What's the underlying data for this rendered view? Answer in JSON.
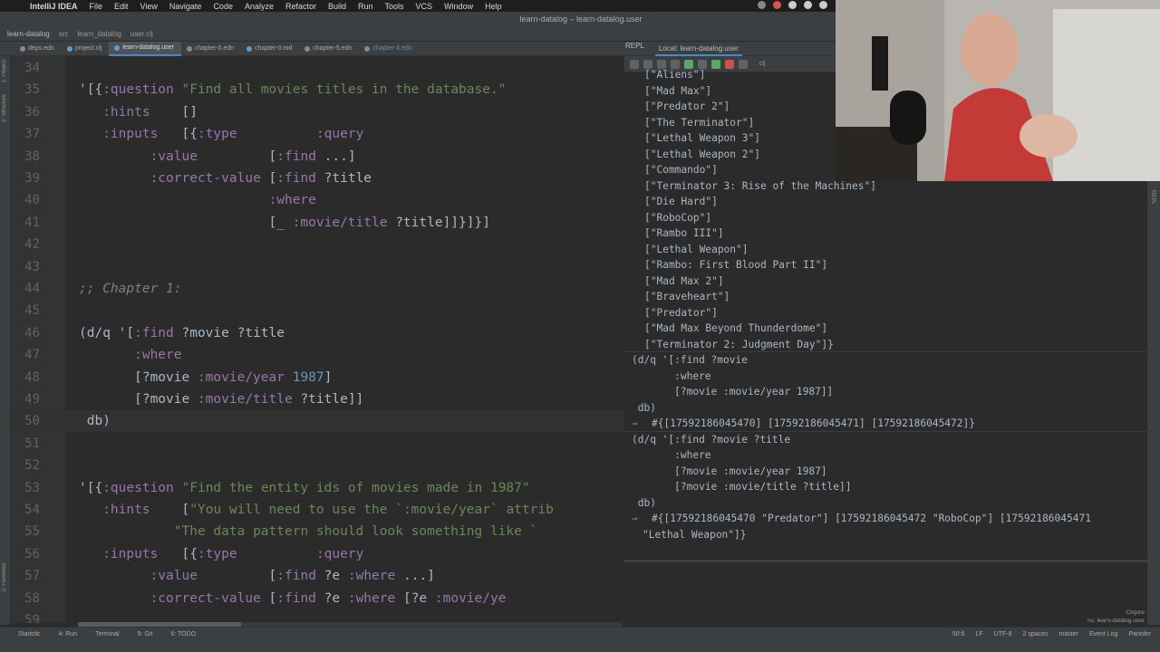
{
  "menubar": {
    "app": "IntelliJ IDEA",
    "items": [
      "File",
      "Edit",
      "View",
      "Navigate",
      "Code",
      "Analyze",
      "Refactor",
      "Build",
      "Run",
      "Tools",
      "VCS",
      "Window",
      "Help"
    ]
  },
  "window": {
    "title": "learn-datalog – learn-datalog.user"
  },
  "breadcrumb": [
    "learn-datalog",
    "src",
    "learn_datalog",
    "user.clj"
  ],
  "tabs": [
    "deps.edn",
    "project.clj",
    "learn-datalog.user",
    "chapter-0.edn",
    "chapter-0.md",
    "chapter-5.edn",
    "chapter-4.edn"
  ],
  "active_tab": "learn-datalog.user",
  "repl_tabs": [
    "REPL",
    "Local: learn-datalog.user"
  ],
  "repl_ns_selector": "clj",
  "left_strip": [
    "1: Project",
    "2: Structure",
    "2: Favorites"
  ],
  "right_strip": "REPL",
  "editor": {
    "lines": [
      {
        "n": "34",
        "code": []
      },
      {
        "n": "35",
        "code": [
          [
            "sym",
            "'[{"
          ],
          [
            "kw",
            ":question"
          ],
          [
            "sym",
            " "
          ],
          [
            "str",
            "\"Find all movies titles in the database.\""
          ]
        ]
      },
      {
        "n": "36",
        "code": [
          [
            "sym",
            "   "
          ],
          [
            "kw",
            ":hints"
          ],
          [
            "sym",
            "    []"
          ]
        ]
      },
      {
        "n": "37",
        "code": [
          [
            "sym",
            "   "
          ],
          [
            "kw",
            ":inputs"
          ],
          [
            "sym",
            "   [{"
          ],
          [
            "kw",
            ":type"
          ],
          [
            "sym",
            "          "
          ],
          [
            "kw",
            ":query"
          ]
        ]
      },
      {
        "n": "38",
        "code": [
          [
            "sym",
            "         "
          ],
          [
            "kw",
            ":value"
          ],
          [
            "sym",
            "         ["
          ],
          [
            "kw",
            ":find"
          ],
          [
            "sym",
            " ...]"
          ]
        ]
      },
      {
        "n": "39",
        "code": [
          [
            "sym",
            "         "
          ],
          [
            "kw",
            ":correct-value"
          ],
          [
            "sym",
            " ["
          ],
          [
            "kw",
            ":find"
          ],
          [
            "sym",
            " ?title"
          ]
        ]
      },
      {
        "n": "40",
        "code": [
          [
            "sym",
            "                        "
          ],
          [
            "kw",
            ":where"
          ]
        ]
      },
      {
        "n": "41",
        "code": [
          [
            "sym",
            "                        [_ "
          ],
          [
            "kw",
            ":movie/title"
          ],
          [
            "sym",
            " ?title]]}]}]"
          ]
        ]
      },
      {
        "n": "42",
        "code": []
      },
      {
        "n": "43",
        "code": []
      },
      {
        "n": "44",
        "code": [
          [
            "cmt",
            ";; Chapter 1:"
          ]
        ]
      },
      {
        "n": "45",
        "code": []
      },
      {
        "n": "46",
        "code": [
          [
            "sym",
            "(d/q '["
          ],
          [
            "kw",
            ":find"
          ],
          [
            "sym",
            " ?movie ?title"
          ]
        ]
      },
      {
        "n": "47",
        "code": [
          [
            "sym",
            "       "
          ],
          [
            "kw",
            ":where"
          ]
        ]
      },
      {
        "n": "48",
        "code": [
          [
            "sym",
            "       [?movie "
          ],
          [
            "kw",
            ":movie/year"
          ],
          [
            "sym",
            " "
          ],
          [
            "num2",
            "1987"
          ],
          [
            "sym",
            "]"
          ]
        ]
      },
      {
        "n": "49",
        "code": [
          [
            "sym",
            "       [?movie "
          ],
          [
            "kw",
            ":movie/title"
          ],
          [
            "sym",
            " ?title]]"
          ]
        ]
      },
      {
        "n": "50",
        "code": [
          [
            "sym",
            " db)"
          ]
        ]
      },
      {
        "n": "51",
        "code": []
      },
      {
        "n": "52",
        "code": []
      },
      {
        "n": "53",
        "code": [
          [
            "sym",
            "'[{"
          ],
          [
            "kw",
            ":question"
          ],
          [
            "sym",
            " "
          ],
          [
            "str",
            "\"Find the entity ids of movies made in 1987\""
          ]
        ]
      },
      {
        "n": "54",
        "code": [
          [
            "sym",
            "   "
          ],
          [
            "kw",
            ":hints"
          ],
          [
            "sym",
            "    ["
          ],
          [
            "str",
            "\"You will need to use the `:movie/year` attrib"
          ]
        ]
      },
      {
        "n": "55",
        "code": [
          [
            "sym",
            "            "
          ],
          [
            "str",
            "\"The data pattern should look something like `"
          ]
        ]
      },
      {
        "n": "56",
        "code": [
          [
            "sym",
            "   "
          ],
          [
            "kw",
            ":inputs"
          ],
          [
            "sym",
            "   [{"
          ],
          [
            "kw",
            ":type"
          ],
          [
            "sym",
            "          "
          ],
          [
            "kw",
            ":query"
          ]
        ]
      },
      {
        "n": "57",
        "code": [
          [
            "sym",
            "         "
          ],
          [
            "kw",
            ":value"
          ],
          [
            "sym",
            "         ["
          ],
          [
            "kw",
            ":find"
          ],
          [
            "sym",
            " ?e "
          ],
          [
            "kw",
            ":where"
          ],
          [
            "sym",
            " ...]"
          ]
        ]
      },
      {
        "n": "58",
        "code": [
          [
            "sym",
            "         "
          ],
          [
            "kw",
            ":correct-value"
          ],
          [
            "sym",
            " ["
          ],
          [
            "kw",
            ":find"
          ],
          [
            "sym",
            " ?e "
          ],
          [
            "kw",
            ":where"
          ],
          [
            "sym",
            " [?e "
          ],
          [
            "kw",
            ":movie/ye"
          ]
        ]
      },
      {
        "n": "59",
        "code": []
      }
    ]
  },
  "repl": {
    "lines": [
      "[\"Aliens\"]",
      "[\"Mad Max\"]",
      "[\"Predator 2\"]",
      "[\"The Terminator\"]",
      "[\"Lethal Weapon 3\"]",
      "[\"Lethal Weapon 2\"]",
      "[\"Commando\"]",
      "[\"Terminator 3: Rise of the Machines\"]",
      "[\"Die Hard\"]",
      "[\"RoboCop\"]",
      "[\"Rambo III\"]",
      "[\"Lethal Weapon\"]",
      "[\"Rambo: First Blood Part II\"]",
      "[\"Mad Max 2\"]",
      "[\"Braveheart\"]",
      "[\"Predator\"]",
      "[\"Mad Max Beyond Thunderdome\"]",
      "[\"Terminator 2: Judgment Day\"]}"
    ],
    "eval1": [
      "(d/q '[:find ?movie",
      "       :where",
      "       [?movie :movie/year 1987]]",
      " db)"
    ],
    "result1": "#{[17592186045470] [17592186045471] [17592186045472]}",
    "eval2": [
      "(d/q '[:find ?movie ?title",
      "       :where",
      "       [?movie :movie/year 1987]",
      "       [?movie :movie/title ?title]]",
      " db)"
    ],
    "result2": "#{[17592186045470 \"Predator\"] [17592186045472 \"RoboCop\"] [17592186045471",
    "result2_cont": "\"Lethal Weapon\"]}",
    "prompt_arrow": "⇒",
    "footer_lang": "Clojure",
    "footer_ns": "ns: learn-datalog.user"
  },
  "statusbar": {
    "left": [
      "Statistic",
      "4: Run",
      "Terminal",
      "9: Git",
      "6: TODO"
    ],
    "right": [
      "50:6",
      "LF",
      "UTF-8",
      "2 spaces",
      "master",
      "Event Log",
      "Parinfer"
    ]
  },
  "colors": {
    "keyword": "#9876aa",
    "string": "#6a8759",
    "comment": "#808080",
    "number": "#6897bb",
    "accent": "#4a88c7"
  }
}
